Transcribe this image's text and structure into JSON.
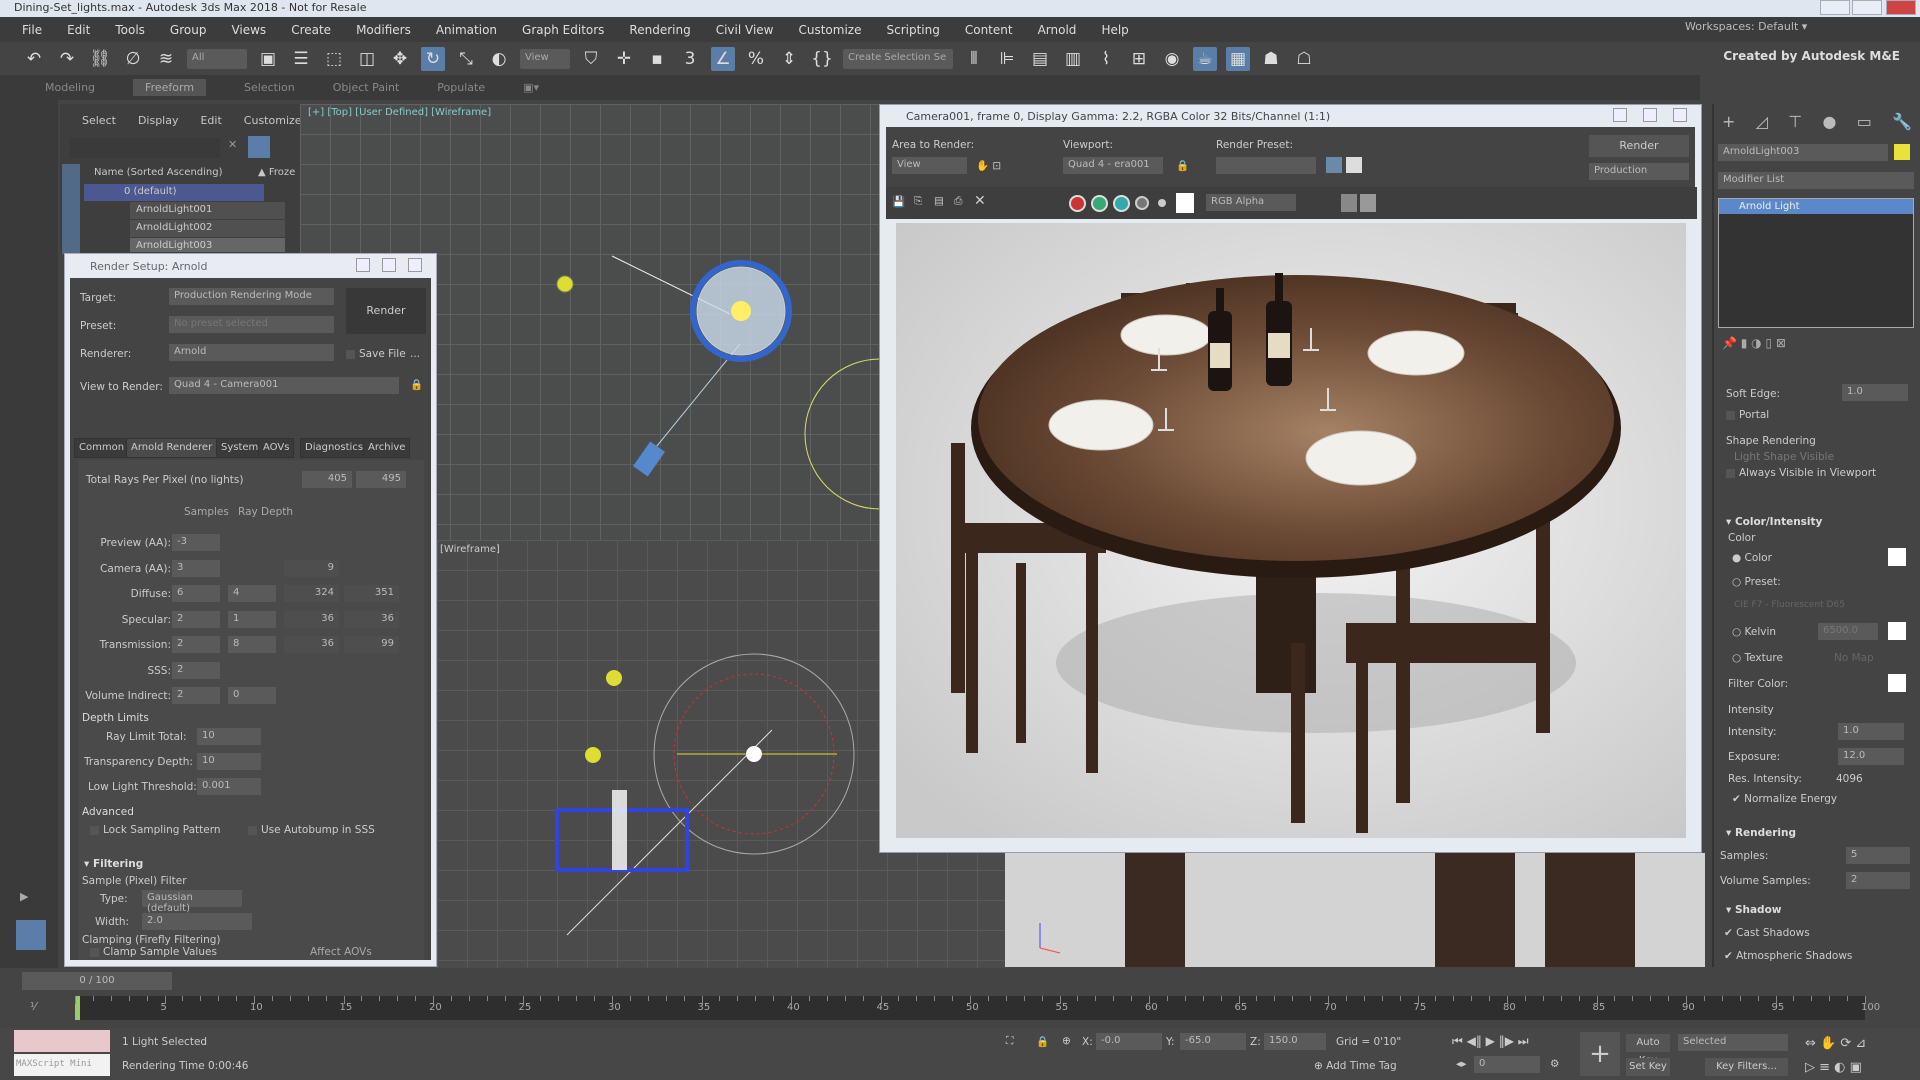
{
  "window": {
    "title": "Dining-Set_lights.max - Autodesk 3ds Max 2018 - Not for Resale"
  },
  "menu": [
    "File",
    "Edit",
    "Tools",
    "Group",
    "Views",
    "Create",
    "Modifiers",
    "Animation",
    "Graph Editors",
    "Rendering",
    "Civil View",
    "Customize",
    "Scripting",
    "Content",
    "Arnold",
    "Help"
  ],
  "workspace": {
    "label": "Workspaces:",
    "value": "Default"
  },
  "toolbar": {
    "filter": "All",
    "ref_coord": "View",
    "selection_set": "Create Selection Se",
    "credit": "Created by Autodesk M&E"
  },
  "ribbon": [
    "Modeling",
    "Freeform",
    "Selection",
    "Object Paint",
    "Populate"
  ],
  "explorer": {
    "menu": [
      "Select",
      "Display",
      "Edit",
      "Customize"
    ],
    "col_name": "Name (Sorted Ascending)",
    "col_frozen": "▲ Froze",
    "items": [
      "0 (default)",
      "ArnoldLight001",
      "ArnoldLight002",
      "ArnoldLight003"
    ]
  },
  "viewports": {
    "top_label": "[+] [Top] [User Defined] [Wireframe]",
    "bottom_label": "[Wireframe]"
  },
  "render_setup": {
    "title": "Render Setup: Arnold",
    "target_label": "Target:",
    "target": "Production Rendering Mode",
    "preset_label": "Preset:",
    "preset": "No preset selected",
    "renderer_label": "Renderer:",
    "renderer": "Arnold",
    "save_file": "Save File",
    "more": "...",
    "view_label": "View to Render:",
    "view": "Quad 4 - Camera001",
    "render_btn": "Render",
    "tabs": [
      "Common",
      "Arnold Renderer",
      "System",
      "AOVs",
      "Diagnostics",
      "Archive"
    ],
    "total_rays_label": "Total Rays Per Pixel (no lights)",
    "total_rays": [
      "405",
      "495"
    ],
    "col_samples": "Samples",
    "col_depth": "Ray Depth",
    "rows": [
      {
        "label": "Preview (AA):",
        "samples": "-3",
        "depth": "",
        "a": "",
        "b": ""
      },
      {
        "label": "Camera (AA):",
        "samples": "3",
        "depth": "",
        "a": "9",
        "b": ""
      },
      {
        "label": "Diffuse:",
        "samples": "6",
        "depth": "4",
        "a": "324",
        "b": "351"
      },
      {
        "label": "Specular:",
        "samples": "2",
        "depth": "1",
        "a": "36",
        "b": "36"
      },
      {
        "label": "Transmission:",
        "samples": "2",
        "depth": "8",
        "a": "36",
        "b": "99"
      },
      {
        "label": "SSS:",
        "samples": "2",
        "depth": "",
        "a": "",
        "b": ""
      },
      {
        "label": "Volume Indirect:",
        "samples": "2",
        "depth": "0",
        "a": "",
        "b": ""
      }
    ],
    "depth_limits": "Depth Limits",
    "ray_limit_label": "Ray Limit Total:",
    "ray_limit": "10",
    "transp_label": "Transparency Depth:",
    "transp": "10",
    "low_light_label": "Low Light Threshold:",
    "low_light": "0.001",
    "advanced": "Advanced",
    "lock_sampling": "Lock Sampling Pattern",
    "autobump": "Use Autobump in SSS",
    "filtering": "Filtering",
    "pixel_filter": "Sample (Pixel) Filter",
    "type_label": "Type:",
    "type": "Gaussian (default)",
    "width_label": "Width:",
    "width": "2.0",
    "clamping": "Clamping (Firefly Filtering)",
    "clamp_values": "Clamp Sample Values",
    "affect_aovs": "Affect AOVs"
  },
  "frame_buffer": {
    "title": "Camera001, frame 0, Display Gamma: 2.2, RGBA Color 32 Bits/Channel (1:1)",
    "area_label": "Area to Render:",
    "area": "View",
    "viewport_label": "Viewport:",
    "viewport": "Quad 4 - era001",
    "preset_label": "Render Preset:",
    "preset": "",
    "render_btn": "Render",
    "mode": "Production",
    "channel": "RGB Alpha"
  },
  "command_panel": {
    "object_name": "ArnoldLight003",
    "object_color": "#e8e23a",
    "modifier_list": "Modifier List",
    "stack": [
      "Arnold Light"
    ],
    "soft_edge_label": "Soft Edge:",
    "soft_edge": "1.0",
    "portal": "Portal",
    "shape_rendering": "Shape Rendering",
    "light_shape_visible": "Light Shape Visible",
    "always_visible": "Always Visible in Viewport",
    "color_intensity": "Color/Intensity",
    "color_group": "Color",
    "color": "Color",
    "preset": "Preset:",
    "preset_value": "CIE F7 - Fluorescent D65",
    "kelvin": "Kelvin",
    "kelvin_value": "6500.0",
    "texture": "Texture",
    "texture_map": "No Map",
    "filter_color": "Filter Color:",
    "intensity_group": "Intensity",
    "intensity_label": "Intensity:",
    "intensity": "1.0",
    "exposure_label": "Exposure:",
    "exposure": "12.0",
    "res_intensity_label": "Res. Intensity:",
    "res_intensity": "4096",
    "normalize": "✔ Normalize Energy",
    "rendering": "Rendering",
    "samples_label": "Samples:",
    "samples": "5",
    "vol_samples_label": "Volume Samples:",
    "vol_samples": "2",
    "shadow": "Shadow",
    "cast_shadows": "✔ Cast Shadows",
    "atmo_shadows": "✔ Atmospheric Shadows"
  },
  "timeline": {
    "frame": "0 / 100",
    "ticks": [
      "5",
      "10",
      "15",
      "20",
      "25",
      "30",
      "35",
      "40",
      "45",
      "50",
      "55",
      "60",
      "65",
      "70",
      "75",
      "80",
      "85",
      "90",
      "95",
      "100"
    ]
  },
  "status": {
    "maxscript": "MAXScript Mini",
    "selected": "1 Light Selected",
    "render_time": "Rendering Time  0:00:46",
    "x_label": "X:",
    "x": "-0.0",
    "y_label": "Y:",
    "y": "-65.0",
    "z_label": "Z:",
    "z": "150.0",
    "grid": "Grid = 0'10\"",
    "add_time_tag": "Add Time Tag",
    "frame": "0",
    "auto_key": "Auto Key",
    "set_key": "Set Key",
    "key_mode": "Selected",
    "key_filters": "Key Filters..."
  }
}
